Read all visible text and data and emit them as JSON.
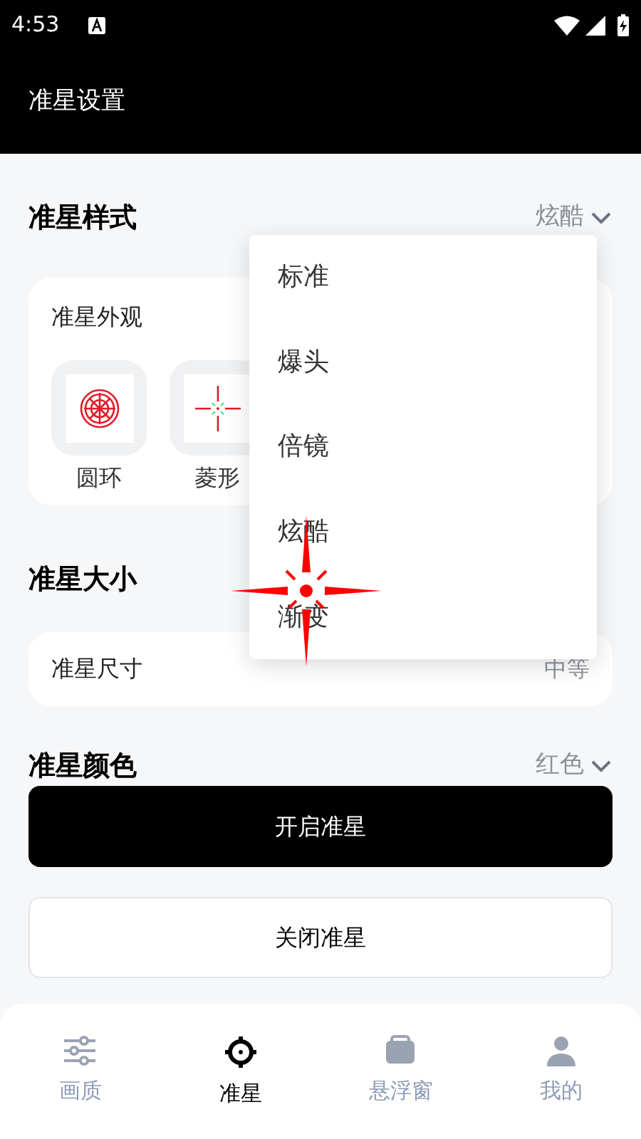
{
  "status_bar": {
    "time": "4:53"
  },
  "app_bar": {
    "title": "准星设置"
  },
  "style_section": {
    "title": "准星样式",
    "value": "炫酷",
    "card": {
      "title": "准星外观",
      "items": [
        {
          "label": "圆环",
          "kind": "ring"
        },
        {
          "label": "菱形",
          "kind": "cross"
        }
      ]
    },
    "menu": [
      "标准",
      "爆头",
      "倍镜",
      "炫酷",
      "渐变"
    ]
  },
  "size_section": {
    "title": "准星大小",
    "row": {
      "label": "准星尺寸",
      "value": "中等"
    }
  },
  "color_section": {
    "title": "准星颜色",
    "value": "红色"
  },
  "buttons": [
    {
      "label": "开启准星",
      "kind": "primary"
    },
    {
      "label": "关闭准星",
      "kind": "outline"
    }
  ],
  "bottom_nav": [
    {
      "label": "画质",
      "kind": "sliders",
      "selected": false
    },
    {
      "label": "准星",
      "kind": "crosshair",
      "selected": true
    },
    {
      "label": "悬浮窗",
      "kind": "window",
      "selected": false
    },
    {
      "label": "我的",
      "kind": "user",
      "selected": false
    }
  ]
}
